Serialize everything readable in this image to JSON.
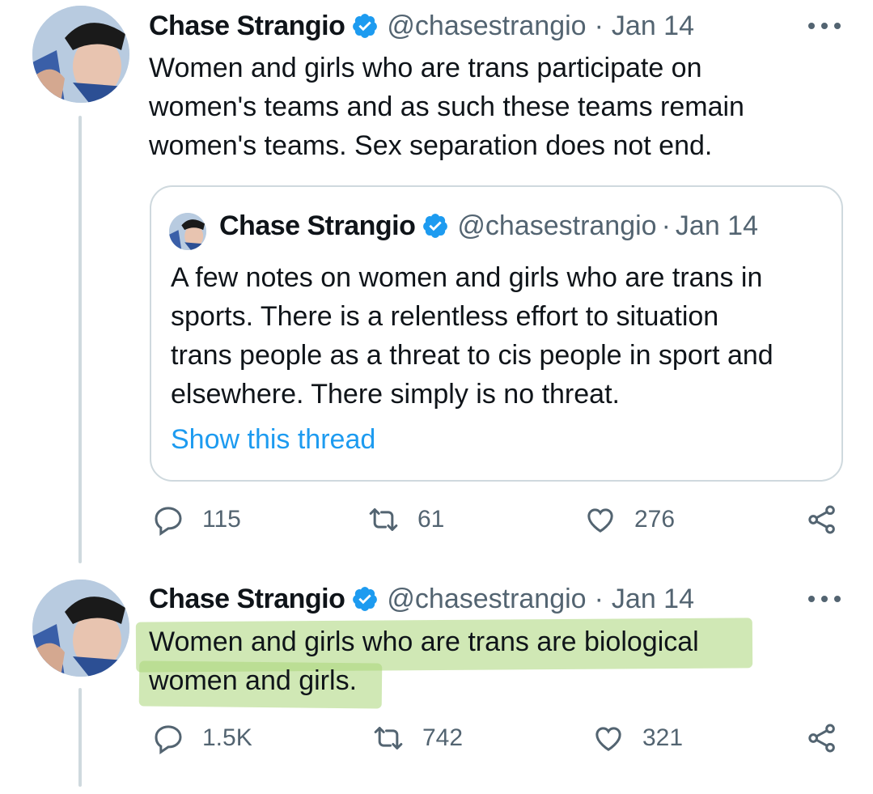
{
  "tweets": [
    {
      "author_name": "Chase Strangio",
      "handle": "@chasestrangio",
      "separator": "·",
      "date": "Jan 14",
      "text_lines": [
        "Women and girls who are trans participate on",
        "women's teams and as such these teams remain",
        "women's teams. Sex separation does not end."
      ],
      "quote": {
        "author_name": "Chase Strangio",
        "handle": "@chasestrangio",
        "separator": "·",
        "date": "Jan 14",
        "text_lines": [
          "A few notes on women and girls who are trans in",
          "sports. There is a relentless effort to situation",
          "trans people as a threat to cis people in sport and",
          "elsewhere. There simply is no threat."
        ],
        "show_thread": "Show this thread"
      },
      "replies": "115",
      "retweets": "61",
      "likes": "276"
    },
    {
      "author_name": "Chase Strangio",
      "handle": "@chasestrangio",
      "separator": "·",
      "date": "Jan 14",
      "text_lines": [
        "Women and girls who are trans are biological",
        "women and girls."
      ],
      "replies": "1.5K",
      "retweets": "742",
      "likes": "321"
    }
  ],
  "icons": {
    "verified": "verified-badge-icon",
    "more": "more-options-icon",
    "reply": "reply-icon",
    "retweet": "retweet-icon",
    "like": "heart-icon",
    "share": "share-icon"
  },
  "colors": {
    "verified_blue": "#1d9bf0",
    "link_blue": "#1d9bf0",
    "secondary_text": "#536471",
    "highlight_green": "#aad678"
  }
}
